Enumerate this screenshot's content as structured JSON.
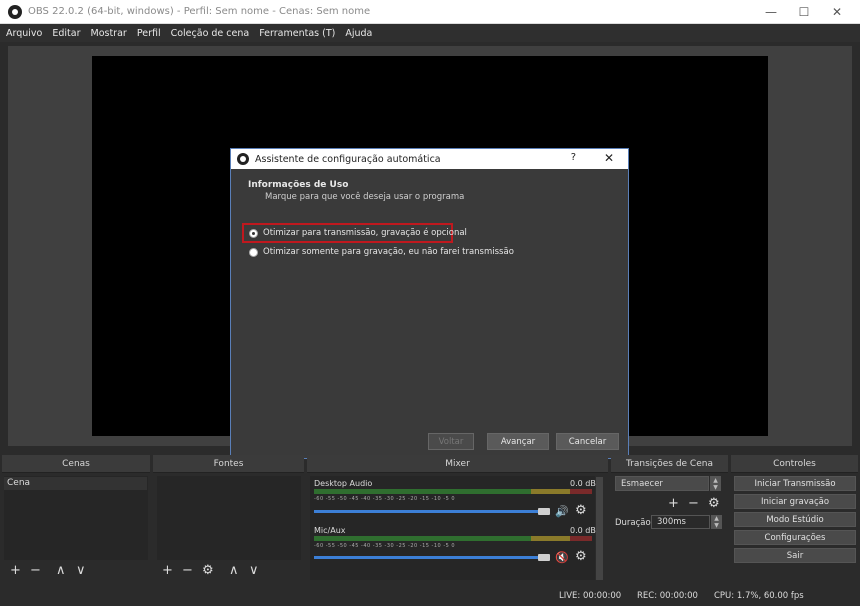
{
  "window": {
    "title": "OBS 22.0.2 (64-bit, windows) - Perfil: Sem nome - Cenas: Sem nome",
    "minimize": "—",
    "maximize": "☐",
    "close": "✕"
  },
  "menu": [
    "Arquivo",
    "Editar",
    "Mostrar",
    "Perfil",
    "Coleção de cena",
    "Ferramentas (T)",
    "Ajuda"
  ],
  "dialog": {
    "title": "Assistente de configuração automática",
    "help": "?",
    "close": "✕",
    "section_title": "Informações de Uso",
    "section_subtitle": "Marque para que você deseja usar o programa",
    "options": [
      {
        "label": "Otimizar para transmissão, gravação é opcional",
        "checked": true
      },
      {
        "label": "Otimizar somente para gravação, eu não farei transmissão",
        "checked": false
      }
    ],
    "buttons": {
      "back": "Voltar",
      "next": "Avançar",
      "cancel": "Cancelar"
    }
  },
  "docks": {
    "scenes": {
      "title": "Cenas",
      "items": [
        "Cena"
      ]
    },
    "sources": {
      "title": "Fontes"
    },
    "mixer": {
      "title": "Mixer",
      "channels": [
        {
          "name": "Desktop Audio",
          "level": "0.0 dB",
          "muted": false
        },
        {
          "name": "Mic/Aux",
          "level": "0.0 dB",
          "muted": true
        }
      ],
      "ticks": "-60  -55  -50  -45  -40  -35  -30  -25  -20  -15  -10  -5  0"
    },
    "transitions": {
      "title": "Transições de Cena",
      "selected": "Esmaecer",
      "duration_label": "Duração",
      "duration_value": "300ms"
    },
    "controls": {
      "title": "Controles",
      "buttons": [
        "Iniciar Transmissão",
        "Iniciar gravação",
        "Modo Estúdio",
        "Configurações",
        "Sair"
      ]
    }
  },
  "status": {
    "live": "LIVE: 00:00:00",
    "rec": "REC: 00:00:00",
    "cpu": "CPU: 1.7%, 60.00 fps"
  },
  "icons": {
    "plus": "+",
    "minus": "−",
    "up": "∧",
    "down": "∨",
    "gear": "⚙",
    "speaker": "🔊",
    "speaker_muted": "🔇"
  }
}
